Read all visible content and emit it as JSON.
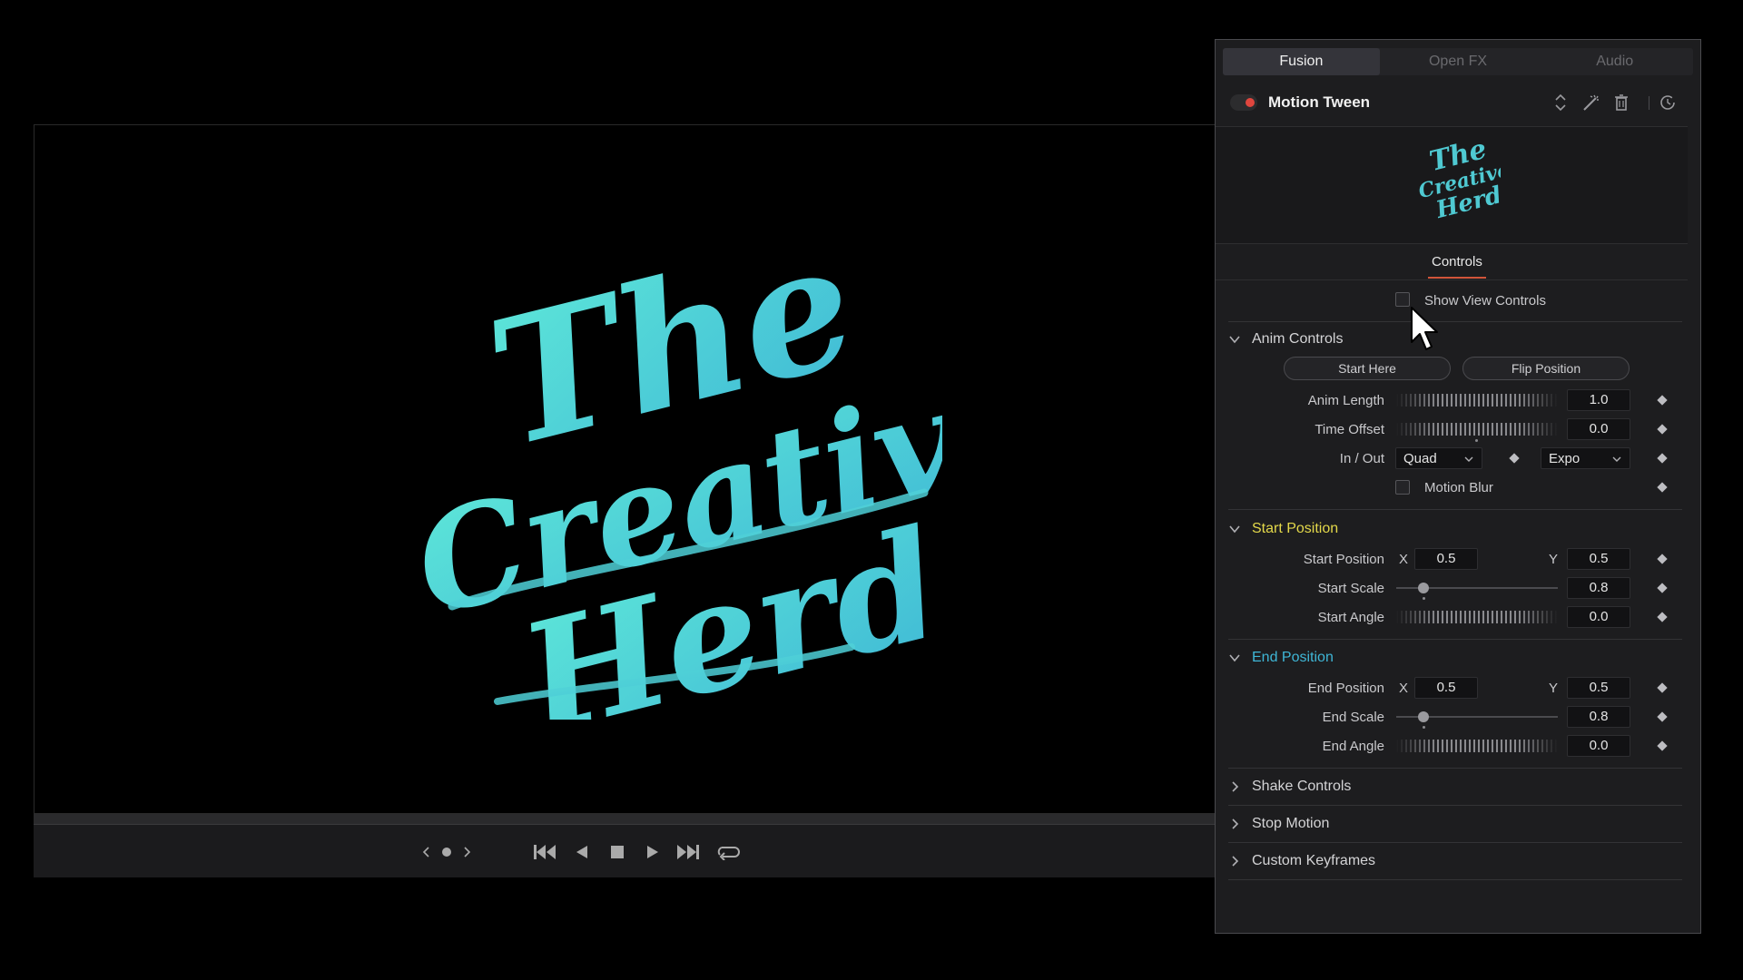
{
  "viewer": {
    "title_art_text": [
      "The",
      "Creative",
      "Herd"
    ],
    "transport_icons": [
      "prev-marker-icon",
      "marker-dot-icon",
      "next-marker-icon",
      "go-to-start-icon",
      "play-reverse-icon",
      "stop-icon",
      "play-icon",
      "go-to-end-icon",
      "loop-icon"
    ]
  },
  "inspector": {
    "tabs": [
      "Fusion",
      "Open FX",
      "Audio"
    ],
    "active_tab": "Fusion",
    "effect_title": "Motion Tween",
    "controls_tab": "Controls",
    "show_view_controls": "Show View Controls",
    "anim": {
      "header": "Anim Controls",
      "start_here": "Start Here",
      "flip_position": "Flip Position",
      "anim_length_label": "Anim Length",
      "anim_length": "1.0",
      "time_offset_label": "Time Offset",
      "time_offset": "0.0",
      "in_out_label": "In / Out",
      "in_ease": "Quad",
      "out_ease": "Expo",
      "motion_blur_label": "Motion Blur"
    },
    "start": {
      "header": "Start Position",
      "pos_label": "Start Position",
      "x_label": "X",
      "x": "0.5",
      "y_label": "Y",
      "y": "0.5",
      "scale_label": "Start Scale",
      "scale": "0.8",
      "angle_label": "Start Angle",
      "angle": "0.0"
    },
    "end": {
      "header": "End Position",
      "pos_label": "End Position",
      "x_label": "X",
      "x": "0.5",
      "y_label": "Y",
      "y": "0.5",
      "scale_label": "End Scale",
      "scale": "0.8",
      "angle_label": "End Angle",
      "angle": "0.0"
    },
    "collapsed_sections": [
      "Shake Controls",
      "Stop Motion",
      "Custom Keyframes"
    ]
  },
  "colors": {
    "accent_teal": "#4fd6cf",
    "start_header": "#e3d84a",
    "end_header": "#3fb6d6",
    "record_dot": "#e0463e",
    "tab_underline": "#d2553a"
  }
}
